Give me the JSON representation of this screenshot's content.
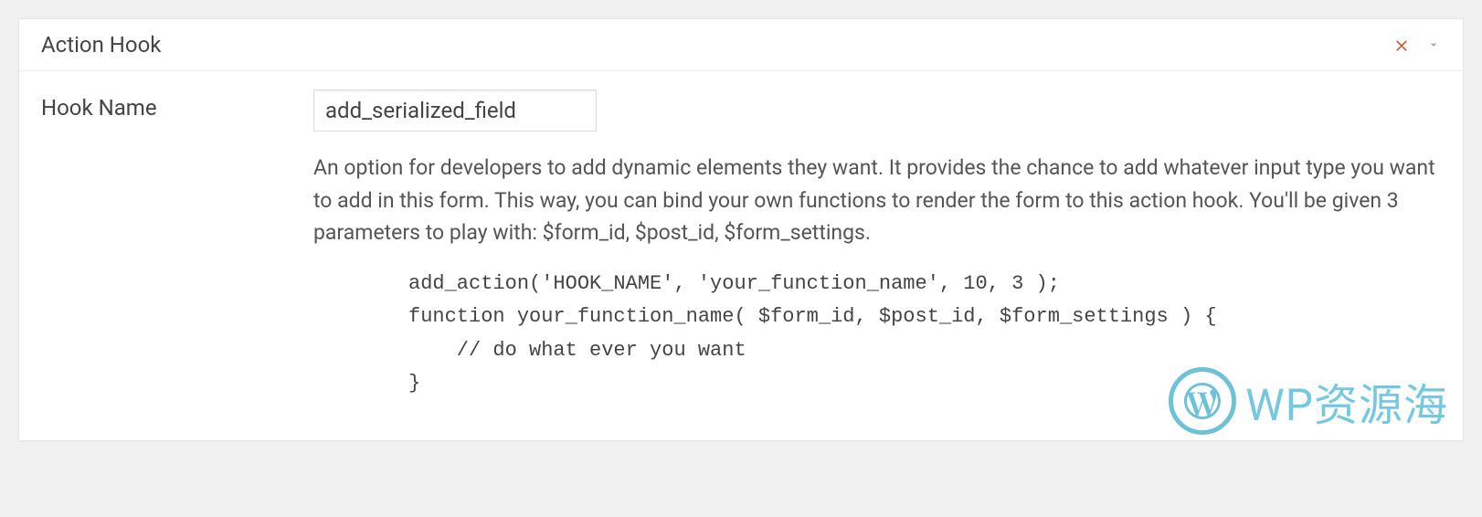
{
  "panel": {
    "title": "Action Hook"
  },
  "field": {
    "label": "Hook Name",
    "value": "add_serialized_field",
    "description": "An option for developers to add dynamic elements they want. It provides the chance to add whatever input type you want to add in this form. This way, you can bind your own functions to render the form to this action hook. You'll be given 3 parameters to play with: $form_id, $post_id, $form_settings.",
    "code": "add_action('HOOK_NAME', 'your_function_name', 10, 3 );\nfunction your_function_name( $form_id, $post_id, $form_settings ) {\n    // do what ever you want\n}"
  },
  "watermark": {
    "text": "WP资源海"
  }
}
